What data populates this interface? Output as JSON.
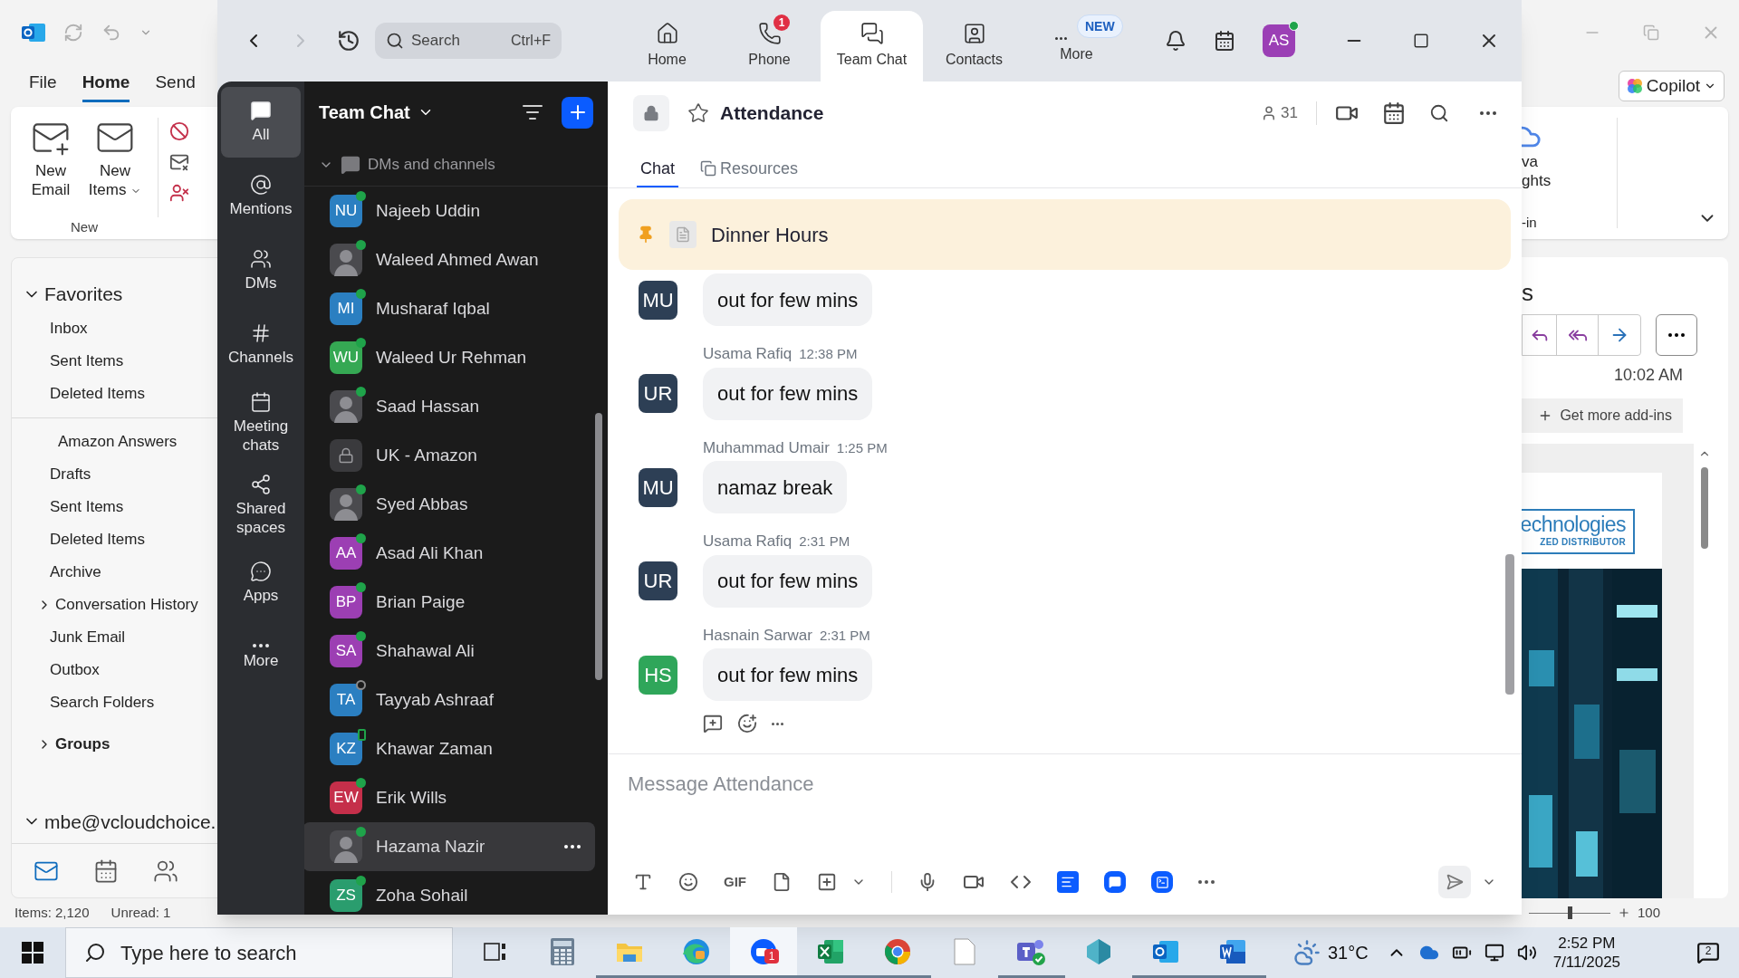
{
  "outlook": {
    "tabs": [
      {
        "label": "File",
        "selected": false
      },
      {
        "label": "Home",
        "selected": true
      },
      {
        "label": "Send",
        "selected": false
      }
    ],
    "ribbon": {
      "new_email": "New Email",
      "new_items": "New Items",
      "group": "New"
    },
    "favorites": {
      "label": "Favorites",
      "expanded": true,
      "items": [
        "Inbox",
        "Sent Items",
        "Deleted Items"
      ]
    },
    "folders": [
      {
        "label": "Amazon Answers",
        "kind": "subfolder"
      },
      {
        "label": "Drafts",
        "kind": "folder"
      },
      {
        "label": "Sent Items",
        "kind": "folder"
      },
      {
        "label": "Deleted Items",
        "kind": "folder"
      },
      {
        "label": "Archive",
        "kind": "folder"
      },
      {
        "label": "Conversation History",
        "kind": "collapsed"
      },
      {
        "label": "Junk Email",
        "kind": "folder"
      },
      {
        "label": "Outbox",
        "kind": "folder"
      },
      {
        "label": "Search Folders",
        "kind": "folder"
      }
    ],
    "groups": {
      "label": "Groups",
      "expanded": false
    },
    "account": {
      "label": "mbe@vcloudchoice.",
      "expanded": true
    },
    "nav": [
      {
        "kind": "mail",
        "selected": true
      },
      {
        "kind": "calendar",
        "selected": false
      },
      {
        "kind": "people",
        "selected": false
      }
    ],
    "status_bar": [
      "Items: 2,120",
      "Unread: 1"
    ],
    "right_ribbon": {
      "copilot": "Copilot",
      "addin_lines": [
        "va",
        "ghts"
      ],
      "group": "-in"
    },
    "reading": {
      "heading": "s",
      "time": "10:02 AM",
      "get_addins": "Get more add-ins",
      "logo": [
        "echnologies",
        "ZED DISTRIBUTOR"
      ],
      "zoom_level": "100",
      "zoom_slider": {
        "level": 0.5
      }
    }
  },
  "zoom": {
    "search": {
      "placeholder": "Search",
      "shortcut": "Ctrl+F"
    },
    "tabs": [
      {
        "label": "Home",
        "kind": "home",
        "selected": false
      },
      {
        "label": "Phone",
        "kind": "phone",
        "badge": "1",
        "selected": false
      },
      {
        "label": "Team Chat",
        "kind": "chat",
        "selected": true
      },
      {
        "label": "Contacts",
        "kind": "contacts",
        "selected": false
      },
      {
        "label": "More",
        "kind": "more",
        "tag": "NEW",
        "selected": false
      }
    ],
    "avatar": {
      "initials": "AS",
      "online": true
    },
    "nav": [
      {
        "label": "All",
        "kind": "all",
        "selected": true
      },
      {
        "label": "Mentions",
        "kind": "mentions",
        "selected": false
      },
      {
        "label": "DMs",
        "kind": "dms",
        "selected": false
      },
      {
        "label": "Channels",
        "kind": "channels",
        "selected": false
      },
      {
        "label": "Meeting chats",
        "kind": "meetings",
        "selected": false
      },
      {
        "label": "Shared spaces",
        "kind": "shared",
        "selected": false
      },
      {
        "label": "Apps",
        "kind": "apps",
        "selected": false
      },
      {
        "label": "More",
        "kind": "more",
        "selected": false
      }
    ],
    "chat_list": {
      "title": "Team Chat",
      "section": {
        "label": "DMs and channels",
        "expanded": true
      },
      "items": [
        {
          "name": "Najeeb Uddin",
          "kind": "initials",
          "initials": "NU",
          "color": "#2b7fc1",
          "online": true,
          "away": false,
          "mobile": false,
          "selected": false
        },
        {
          "name": "Waleed Ahmed Awan",
          "online": true,
          "away": false,
          "mobile": false,
          "selected": false
        },
        {
          "name": "Musharaf Iqbal",
          "kind": "initials",
          "initials": "MI",
          "color": "#2b7fc1",
          "online": true,
          "away": false,
          "mobile": false,
          "selected": false
        },
        {
          "name": "Waleed Ur Rehman",
          "kind": "initials",
          "initials": "WU",
          "color": "#35a853",
          "online": true,
          "away": false,
          "mobile": false,
          "selected": false
        },
        {
          "name": "Saad Hassan",
          "online": true,
          "away": false,
          "mobile": false,
          "selected": false
        },
        {
          "name": "UK - Amazon",
          "kind": "channel",
          "online": false,
          "away": false,
          "mobile": false,
          "selected": false
        },
        {
          "name": "Syed Abbas",
          "online": true,
          "away": false,
          "mobile": false,
          "selected": false
        },
        {
          "name": "Asad Ali Khan",
          "kind": "initials",
          "initials": "AA",
          "color": "#9c3fb3",
          "online": true,
          "away": false,
          "mobile": false,
          "selected": false
        },
        {
          "name": "Brian Paige",
          "kind": "initials",
          "initials": "BP",
          "color": "#9c3fb3",
          "online": true,
          "away": false,
          "mobile": false,
          "selected": false
        },
        {
          "name": "Shahawal Ali",
          "kind": "initials",
          "initials": "SA",
          "color": "#9c3fb3",
          "online": true,
          "away": false,
          "mobile": false,
          "selected": false
        },
        {
          "name": "Tayyab Ashraaf",
          "kind": "initials",
          "initials": "TA",
          "color": "#2b7fc1",
          "online": false,
          "away": true,
          "mobile": false,
          "selected": false
        },
        {
          "name": "Khawar Zaman",
          "kind": "initials",
          "initials": "KZ",
          "color": "#2b7fc1",
          "online": false,
          "away": false,
          "mobile": true,
          "selected": false
        },
        {
          "name": "Erik Wills",
          "kind": "initials",
          "initials": "EW",
          "color": "#c52f4a",
          "online": true,
          "away": false,
          "mobile": false,
          "selected": false
        },
        {
          "name": "Hazama Nazir",
          "online": true,
          "away": false,
          "mobile": false,
          "selected": true
        },
        {
          "name": "Zoha Sohail",
          "kind": "initials",
          "initials": "ZS",
          "color": "#2a9d6e",
          "online": true,
          "away": false,
          "mobile": false,
          "selected": false
        }
      ]
    },
    "channel": {
      "title": "Attendance",
      "starred": false,
      "members": "31",
      "tabs": [
        {
          "label": "Chat",
          "selected": true
        },
        {
          "label": "Resources",
          "selected": false
        }
      ],
      "pinned": "Dinner Hours",
      "messages": [
        {
          "initials": "MU",
          "color": "#2d3f55",
          "text": "out for few mins"
        },
        {
          "sender": "Usama Rafiq",
          "time": "12:38 PM",
          "initials": "UR",
          "color": "#2d3f55",
          "text": "out for few mins"
        },
        {
          "sender": "Muhammad Umair",
          "time": "1:25 PM",
          "initials": "MU",
          "color": "#2d3f55",
          "text": "namaz break"
        },
        {
          "sender": "Usama Rafiq",
          "time": "2:31 PM",
          "initials": "UR",
          "color": "#2d3f55",
          "text": "out for few mins"
        },
        {
          "sender": "Hasnain Sarwar",
          "time": "2:31 PM",
          "initials": "HS",
          "color": "#2fa65a",
          "text": "out for few mins"
        }
      ],
      "composer": {
        "placeholder": "Message Attendance",
        "gif": "GIF"
      }
    }
  },
  "taskbar": {
    "search": {
      "placeholder": "Type here to search"
    },
    "apps": [
      {
        "kind": "taskview",
        "running": false,
        "active": false
      },
      {
        "kind": "calculator",
        "running": false,
        "active": false
      },
      {
        "kind": "folder",
        "running": true,
        "active": false
      },
      {
        "kind": "edge",
        "running": true,
        "active": false
      },
      {
        "kind": "zoom",
        "badge": "1",
        "running": true,
        "active": true
      },
      {
        "kind": "excel",
        "running": true,
        "active": false
      },
      {
        "kind": "chrome",
        "running": true,
        "active": false
      },
      {
        "kind": "doc",
        "running": false,
        "active": false
      },
      {
        "kind": "teams",
        "running": true,
        "active": false
      },
      {
        "kind": "gem",
        "running": false,
        "active": false
      },
      {
        "kind": "outlook",
        "running": true,
        "active": false
      },
      {
        "kind": "word",
        "running": true,
        "active": false
      }
    ],
    "weather": "31°C",
    "time": "2:52 PM",
    "date": "7/11/2025",
    "notifications": "2"
  }
}
